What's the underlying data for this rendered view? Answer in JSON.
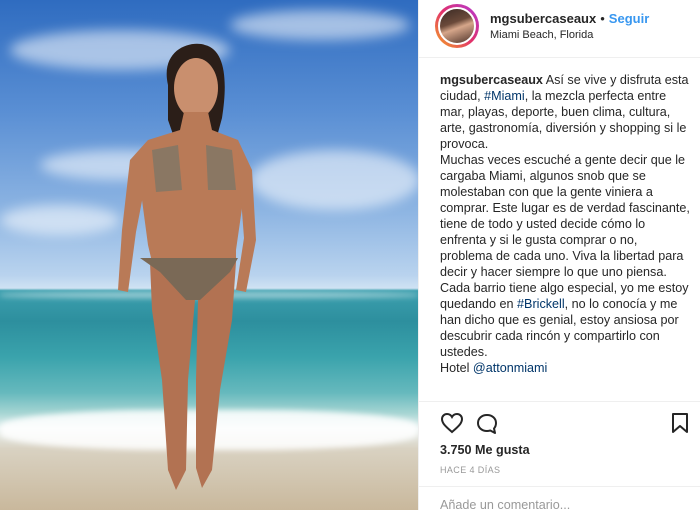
{
  "post": {
    "image_alt": "",
    "username": "mgsubercaseaux",
    "dot": "•",
    "follow_label": "Seguir",
    "location": "Miami Beach, Florida"
  },
  "caption": {
    "username": "mgsubercaseaux",
    "p1_a": " Así se vive y disfruta esta ciudad, ",
    "p1_tag": "#Miami",
    "p1_b": ", la mezcla perfecta entre mar, playas, deporte, buen clima, cultura, arte, gastronomía, diversión y shopping si le provoca.",
    "p2": "Muchas veces escuché a gente decir que le cargaba Miami, algunos snob que se molestaban con que la gente viniera a comprar. Este lugar es de verdad fascinante, tiene de todo y usted decide cómo lo enfrenta y si le gusta comprar o no, problema de cada uno. Viva la libertad para decir y hacer siempre lo que uno piensa.",
    "p3_a": "Cada barrio tiene algo especial, yo me estoy quedando en ",
    "p3_tag": "#Brickell",
    "p3_b": ", no lo conocía y me han dicho que es genial, estoy ansiosa por descubrir cada rincón y compartirlo con ustedes.",
    "p4_a": "Hotel ",
    "p4_tag": "@attonmiami"
  },
  "actions": {
    "like_icon": "heart-icon",
    "comment_icon": "comment-icon",
    "save_icon": "bookmark-icon"
  },
  "likes": "3.750 Me gusta",
  "time": "HACE 4 DÍAS",
  "comment_placeholder": "Añade un comentario..."
}
